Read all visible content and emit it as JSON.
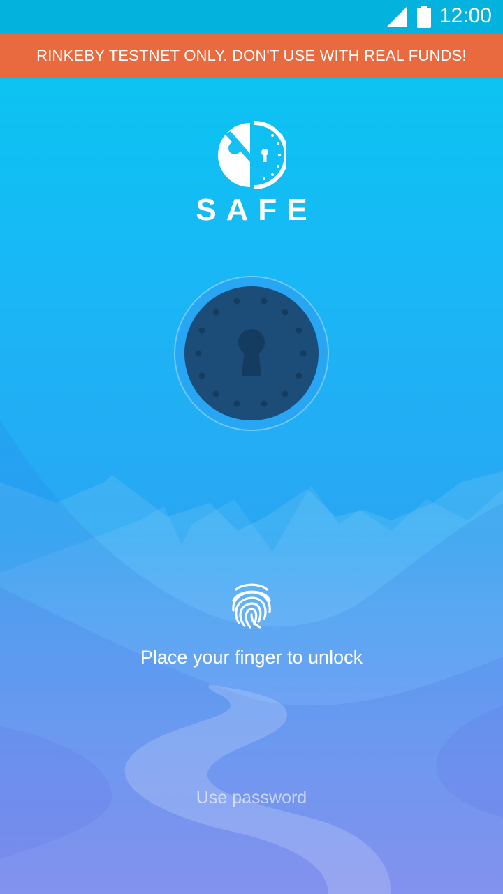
{
  "status_bar": {
    "time": "12:00",
    "signal_icon": "signal-icon",
    "battery_icon": "battery-icon"
  },
  "banner": {
    "text": "RINKEBY TESTNET ONLY. DON'T USE WITH REAL FUNDS!"
  },
  "brand": {
    "name": "SAFE",
    "logo_icon": "safe-logo-icon"
  },
  "lock": {
    "icon": "keyhole-lock-icon"
  },
  "fingerprint": {
    "icon": "fingerprint-icon",
    "instruction": "Place your finger to unlock"
  },
  "actions": {
    "use_password": "Use password"
  },
  "colors": {
    "status_bar": "#03b3de",
    "banner": "#e96a3f",
    "background_top": "#06c8ef",
    "background_bottom": "#9a8ef2",
    "lock_face": "#1c4c78",
    "lock_ring": "#2a9ff0"
  }
}
